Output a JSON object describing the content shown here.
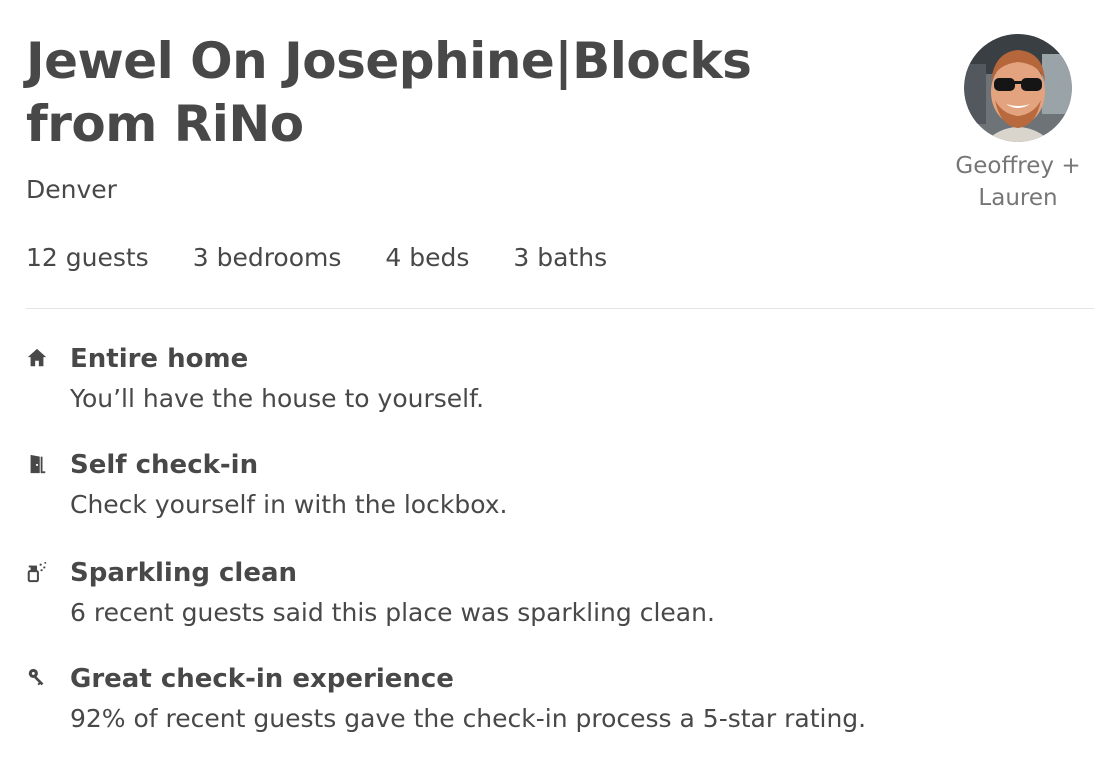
{
  "listing": {
    "title": "Jewel On Josephine|Blocks from RiNo",
    "location": "Denver"
  },
  "host": {
    "name": "Geoffrey + Lauren"
  },
  "stats": {
    "guests": "12 guests",
    "bedrooms": "3 bedrooms",
    "beds": "4 beds",
    "baths": "3 baths"
  },
  "highlights": [
    {
      "icon": "home-icon",
      "title": "Entire home",
      "description": "You’ll have the house to yourself."
    },
    {
      "icon": "door-icon",
      "title": "Self check-in",
      "description": "Check yourself in with the lockbox."
    },
    {
      "icon": "spray-bottle-icon",
      "title": "Sparkling clean",
      "description": "6 recent guests said this place was sparkling clean."
    },
    {
      "icon": "key-icon",
      "title": "Great check-in experience",
      "description": "92% of recent guests gave the check-in process a 5-star rating."
    }
  ],
  "colors": {
    "text": "#484848",
    "muted": "#767676",
    "divider": "#e4e4e4"
  }
}
